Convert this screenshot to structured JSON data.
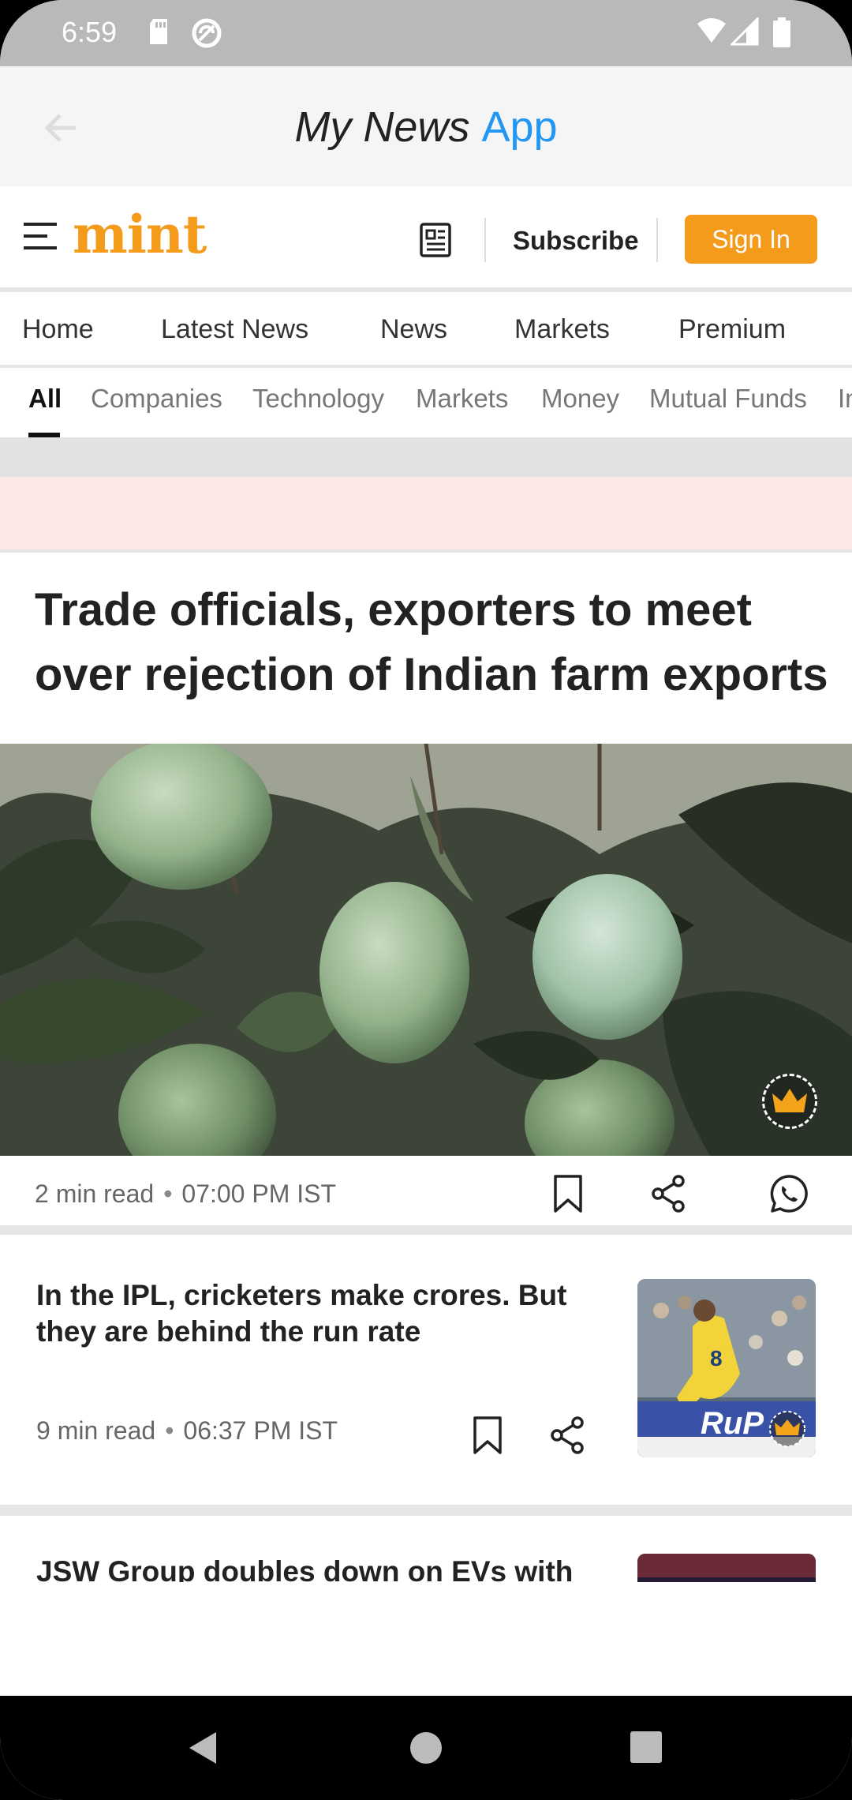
{
  "status_bar": {
    "time": "6:59"
  },
  "app_bar": {
    "title_part1": "My News",
    "title_part2": "App"
  },
  "header": {
    "logo": "mint",
    "subscribe": "Subscribe",
    "sign_in": "Sign In"
  },
  "nav": {
    "items": [
      "Home",
      "Latest News",
      "News",
      "Markets",
      "Premium"
    ]
  },
  "categories": {
    "items": [
      "All",
      "Companies",
      "Technology",
      "Markets",
      "Money",
      "Mutual Funds",
      "In"
    ],
    "active": "All"
  },
  "lead_story": {
    "title": "Trade officials, exporters to meet over rejection of Indian farm exports",
    "read_time": "2 min read",
    "time": "07:00 PM IST"
  },
  "stories": [
    {
      "title": "In the IPL, cricketers make crores. But they are behind the run rate",
      "read_time": "9 min read",
      "time": "06:37 PM IST",
      "thumb_text": "RuP"
    },
    {
      "title": "JSW Group doubles down on EVs with"
    }
  ],
  "colors": {
    "accent": "#f49b1b",
    "app_blue": "#2196f3"
  }
}
